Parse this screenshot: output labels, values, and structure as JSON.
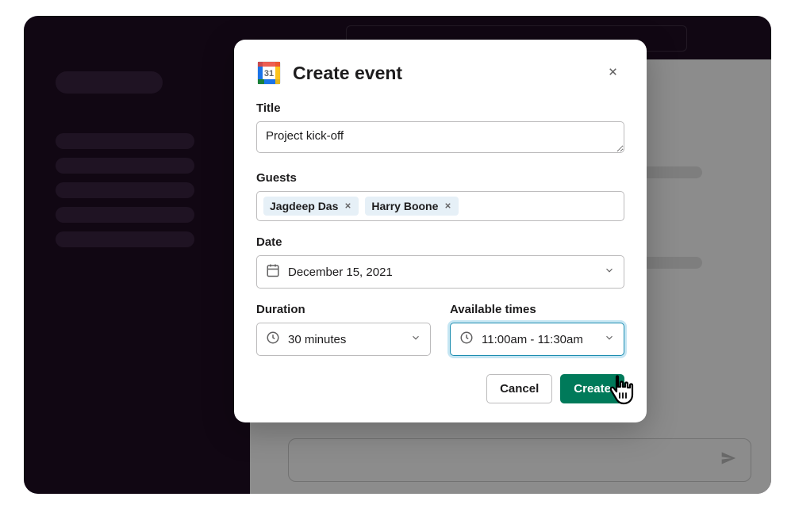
{
  "modal": {
    "title": "Create event",
    "icon_date": "31",
    "fields": {
      "title_label": "Title",
      "title_value": "Project kick-off",
      "guests_label": "Guests",
      "guests": [
        "Jagdeep Das",
        "Harry Boone"
      ],
      "date_label": "Date",
      "date_value": "December 15, 2021",
      "duration_label": "Duration",
      "duration_value": "30 minutes",
      "available_label": "Available times",
      "available_value": "11:00am - 11:30am"
    },
    "buttons": {
      "cancel": "Cancel",
      "create": "Create"
    }
  }
}
